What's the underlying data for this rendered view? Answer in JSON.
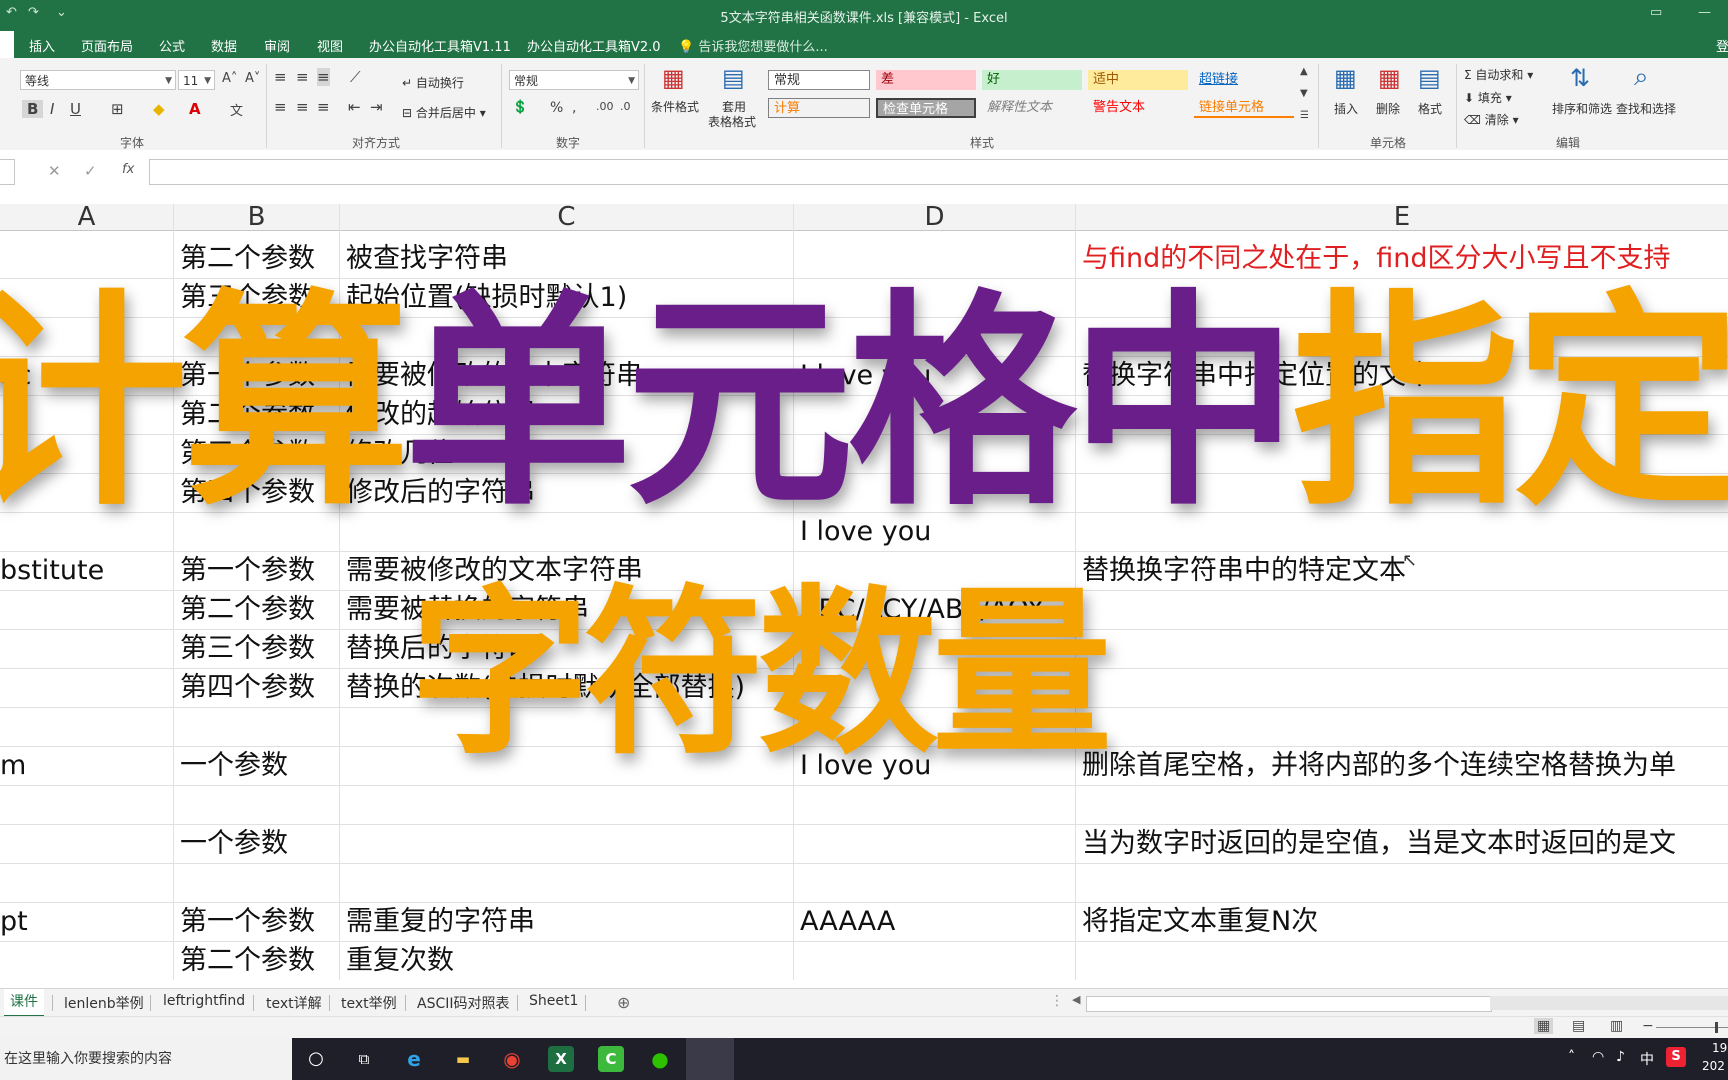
{
  "window": {
    "title": "5文本字符串相关函数课件.xls  [兼容模式] - Excel"
  },
  "tabs": [
    "插入",
    "页面布局",
    "公式",
    "数据",
    "审阅",
    "视图",
    "办公自动化工具箱V1.11",
    "办公自动化工具箱V2.0"
  ],
  "tell_me": "告诉我您想要做什么...",
  "account": "登",
  "ribbon": {
    "font_name": "等线",
    "font_size": "11",
    "wrap_text": "自动换行",
    "merge_center": "合并后居中",
    "number_format": "常规",
    "cond_format": "条件格式",
    "table_format_1": "套用",
    "table_format_2": "表格格式",
    "styles": {
      "normal": "常规",
      "bad": "差",
      "good": "好",
      "neutral": "适中",
      "hyperlink": "超链接",
      "calc": "计算",
      "check_cell": "检查单元格",
      "explanatory": "解释性文本",
      "warning": "警告文本",
      "linked_cell": "链接单元格"
    },
    "insert": "插入",
    "delete": "删除",
    "format": "格式",
    "autosum": "自动求和",
    "fill": "填充",
    "clear": "清除",
    "sort_filter": "排序和筛选",
    "find_select": "查找和选择",
    "groups": {
      "font": "字体",
      "alignment": "对齐方式",
      "number": "数字",
      "styles": "样式",
      "cells": "单元格",
      "editing": "编辑"
    }
  },
  "formula_bar": {
    "cancel": "✕",
    "enter": "✓",
    "fx": "fx",
    "value": ""
  },
  "columns": [
    "A",
    "B",
    "C",
    "D",
    "E"
  ],
  "cells": {
    "r1": {
      "b": "第二个参数",
      "c": "被查找字符串",
      "d": "",
      "e": "与find的不同之处在于，find区分大小写且不支持"
    },
    "r2": {
      "b": "第三个参数",
      "c": "起始位置(缺损时默认1)"
    },
    "r4": {
      "a": "ac",
      "b": "第一个参数",
      "c": "需要被修改的文本字符串",
      "d": "I love you",
      "e": "替换字符串中指定位置的文本"
    },
    "r5": {
      "b": "第二个参数",
      "c": "修改的起始位置"
    },
    "r6": {
      "b": "第三个参数",
      "c": "修改几位"
    },
    "r7": {
      "b": "第四个参数",
      "c": "修改后的字符串"
    },
    "r8": {
      "d": "I love you"
    },
    "r9": {
      "a": "bstitute",
      "b": "第一个参数",
      "c": "需要被修改的文本字符串",
      "e": "替换换字符串中的特定文本"
    },
    "r10": {
      "b": "第二个参数",
      "c": "需要被替换的字符串",
      "d": "ABC/ACY/ABE/AOY"
    },
    "r11": {
      "b": "第三个参数",
      "c": "替换后的字符串"
    },
    "r12": {
      "b": "第四个参数",
      "c": "替换的次数(缺损时默认全部替换)"
    },
    "r14": {
      "a": "m",
      "b": "一个参数",
      "d": "I love you",
      "e": "删除首尾空格，并将内部的多个连续空格替换为单"
    },
    "r16": {
      "b": "一个参数",
      "e": "当为数字时返回的是空值，当是文本时返回的是文"
    },
    "r18": {
      "a": "pt",
      "b": "第一个参数",
      "c": "需重复的字符串",
      "d": "AAAAA",
      "e": "将指定文本重复N次"
    },
    "r19": {
      "b": "第二个参数",
      "c": "重复次数"
    }
  },
  "overlay": {
    "line1_a": "计算",
    "line1_b": "单元格中",
    "line1_c": "指定",
    "line2": "字符数量"
  },
  "sheet_tabs": [
    "课件",
    "lenlenb举例",
    "leftrightfind",
    "text详解",
    "text举例",
    "ASCII码对照表",
    "Sheet1"
  ],
  "taskbar": {
    "search": "在这里输入你要搜索的内容",
    "ime": "中",
    "clock": "19",
    "date": "202"
  },
  "colors": {
    "excel_green": "#217346",
    "overlay_orange": "#f5a300",
    "overlay_purple": "#6a1e8a",
    "red_text": "#e02020"
  }
}
